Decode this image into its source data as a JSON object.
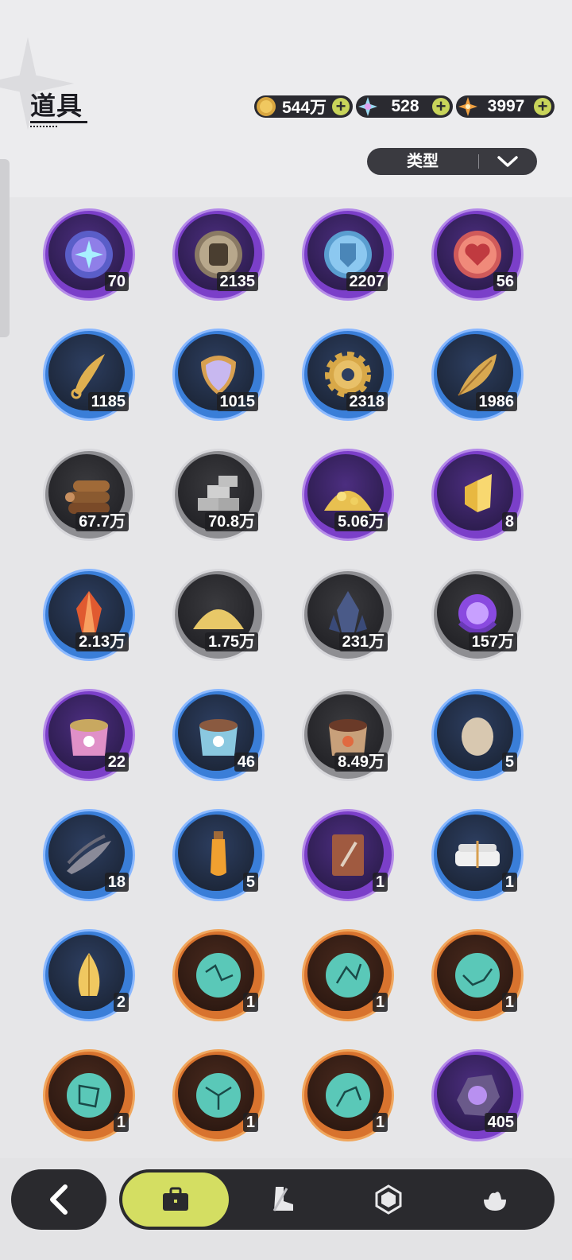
{
  "header": {
    "title": "道具",
    "currencies": [
      {
        "icon": "coin-icon",
        "value": "544万"
      },
      {
        "icon": "crystal-icon",
        "value": "528"
      },
      {
        "icon": "star-gem-icon",
        "value": "3997"
      }
    ],
    "filter_label": "类型"
  },
  "items": [
    {
      "icon": "moon-star-emblem-icon",
      "count": "70",
      "rarity": "purple"
    },
    {
      "icon": "fist-emblem-icon",
      "count": "2135",
      "rarity": "purple"
    },
    {
      "icon": "shield-emblem-icon",
      "count": "2207",
      "rarity": "purple"
    },
    {
      "icon": "heart-emblem-icon",
      "count": "56",
      "rarity": "purple"
    },
    {
      "icon": "golden-fang-icon",
      "count": "1185",
      "rarity": "blue"
    },
    {
      "icon": "scale-shield-icon",
      "count": "1015",
      "rarity": "blue"
    },
    {
      "icon": "gear-icon",
      "count": "2318",
      "rarity": "blue"
    },
    {
      "icon": "golden-leaf-icon",
      "count": "1986",
      "rarity": "blue"
    },
    {
      "icon": "wood-logs-icon",
      "count": "67.7万",
      "rarity": "gray"
    },
    {
      "icon": "stone-bricks-icon",
      "count": "70.8万",
      "rarity": "gray"
    },
    {
      "icon": "gold-ore-icon",
      "count": "5.06万",
      "rarity": "purple"
    },
    {
      "icon": "gold-crystal-icon",
      "count": "8",
      "rarity": "purple"
    },
    {
      "icon": "red-crystal-icon",
      "count": "2.13万",
      "rarity": "blue"
    },
    {
      "icon": "sand-pile-icon",
      "count": "1.75万",
      "rarity": "gray"
    },
    {
      "icon": "dark-crystal-icon",
      "count": "231万",
      "rarity": "gray"
    },
    {
      "icon": "purple-orb-icon",
      "count": "157万",
      "rarity": "gray"
    },
    {
      "icon": "pink-food-bag-icon",
      "count": "22",
      "rarity": "purple"
    },
    {
      "icon": "blue-food-bag-icon",
      "count": "46",
      "rarity": "blue"
    },
    {
      "icon": "brown-food-bag-icon",
      "count": "8.49万",
      "rarity": "gray"
    },
    {
      "icon": "egg-icon",
      "count": "5",
      "rarity": "blue"
    },
    {
      "icon": "feather-bundle-icon",
      "count": "18",
      "rarity": "blue"
    },
    {
      "icon": "potion-vial-icon",
      "count": "5",
      "rarity": "blue"
    },
    {
      "icon": "sword-book-icon",
      "count": "1",
      "rarity": "purple"
    },
    {
      "icon": "white-towel-icon",
      "count": "1",
      "rarity": "blue"
    },
    {
      "icon": "yellow-leaf-icon",
      "count": "2",
      "rarity": "blue"
    },
    {
      "icon": "constellation-orb-icon",
      "count": "1",
      "rarity": "orange"
    },
    {
      "icon": "constellation-orb-icon",
      "count": "1",
      "rarity": "orange"
    },
    {
      "icon": "constellation-orb-icon",
      "count": "1",
      "rarity": "orange"
    },
    {
      "icon": "constellation-orb-icon",
      "count": "1",
      "rarity": "orange"
    },
    {
      "icon": "constellation-orb-icon",
      "count": "1",
      "rarity": "orange"
    },
    {
      "icon": "constellation-orb-icon",
      "count": "1",
      "rarity": "orange"
    },
    {
      "icon": "purple-ore-icon",
      "count": "405",
      "rarity": "purple"
    }
  ],
  "nav": {
    "back_icon": "back-arrow-icon",
    "tabs": [
      {
        "icon": "briefcase-icon",
        "active": true
      },
      {
        "icon": "boot-sword-icon",
        "active": false
      },
      {
        "icon": "hexagon-gem-icon",
        "active": false
      },
      {
        "icon": "cream-pot-icon",
        "active": false
      }
    ]
  },
  "colors": {
    "accent": "#d4de62",
    "purple_rarity": "#7b3fc9",
    "blue_rarity": "#3a7ed8",
    "gray_rarity": "#8e8e92",
    "orange_rarity": "#d8732e"
  }
}
